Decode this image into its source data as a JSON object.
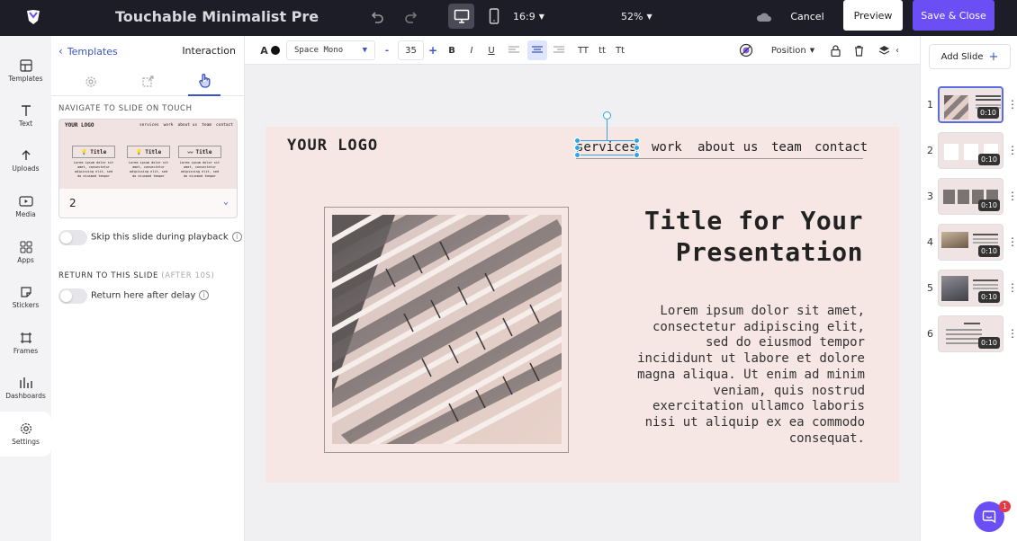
{
  "topbar": {
    "title": "Touchable Minimalist Pre",
    "aspect": "16:9",
    "zoom": "52%",
    "cancel": "Cancel",
    "preview": "Preview",
    "save_close": "Save & Close"
  },
  "sidebar": {
    "items": [
      {
        "label": "Templates",
        "icon": "templates-icon"
      },
      {
        "label": "Text",
        "icon": "text-icon"
      },
      {
        "label": "Uploads",
        "icon": "upload-icon"
      },
      {
        "label": "Media",
        "icon": "media-icon"
      },
      {
        "label": "Apps",
        "icon": "apps-icon"
      },
      {
        "label": "Stickers",
        "icon": "sticker-icon"
      },
      {
        "label": "Frames",
        "icon": "frame-icon"
      },
      {
        "label": "Dashboards",
        "icon": "dashboard-icon"
      },
      {
        "label": "Settings",
        "icon": "settings-icon"
      }
    ]
  },
  "panel": {
    "back_label": "Templates",
    "title": "Interaction",
    "navigate_heading": "NAVIGATE TO SLIDE ON TOUCH",
    "selected_slide": "2",
    "preview": {
      "logo": "YOUR LOGO",
      "nav": [
        "services",
        "work",
        "about us",
        "team",
        "contact"
      ],
      "card_title": "Title",
      "card_text": "Lorem ipsum dolor sit amet, consectetur adipiscing elit, sed do eiusmod tempor"
    },
    "skip_label": "Skip this slide during playback",
    "return_heading": "RETURN TO THIS SLIDE",
    "return_after": "(AFTER 10S)",
    "return_label": "Return here after delay"
  },
  "toolbar": {
    "text_color_letter": "A",
    "font": "Space Mono",
    "size": "35",
    "minus": "-",
    "plus": "+",
    "bold": "B",
    "italic": "I",
    "underline": "U",
    "case_upper": "TT",
    "case_lower": "tt",
    "case_title": "Tt",
    "position": "Position"
  },
  "slide": {
    "logo": "YOUR LOGO",
    "nav": [
      "services",
      "work",
      "about us",
      "team",
      "contact"
    ],
    "title_line1": "Title for Your",
    "title_line2": "Presentation",
    "body_lines": [
      "Lorem ipsum dolor sit amet,",
      "consectetur adipiscing elit,",
      "sed do eiusmod tempor",
      "incididunt ut labore et dolore",
      "magna aliqua. Ut enim ad minim",
      "veniam, quis nostrud",
      "exercitation ullamco laboris",
      "nisi ut aliquip ex ea commodo",
      "consequat."
    ]
  },
  "slides_panel": {
    "add_slide": "Add Slide",
    "add_plus": "+",
    "slides": [
      {
        "num": "1",
        "duration": "0:10"
      },
      {
        "num": "2",
        "duration": "0:10"
      },
      {
        "num": "3",
        "duration": "0:10"
      },
      {
        "num": "4",
        "duration": "0:10"
      },
      {
        "num": "5",
        "duration": "0:10"
      },
      {
        "num": "6",
        "duration": "0:10"
      }
    ]
  },
  "chat": {
    "badge": "1"
  },
  "colors": {
    "accent": "#6c4ef5",
    "topbar_bg": "#1d1d28",
    "slide_bg": "#f6e6e4",
    "selection": "#2fa4e7"
  }
}
